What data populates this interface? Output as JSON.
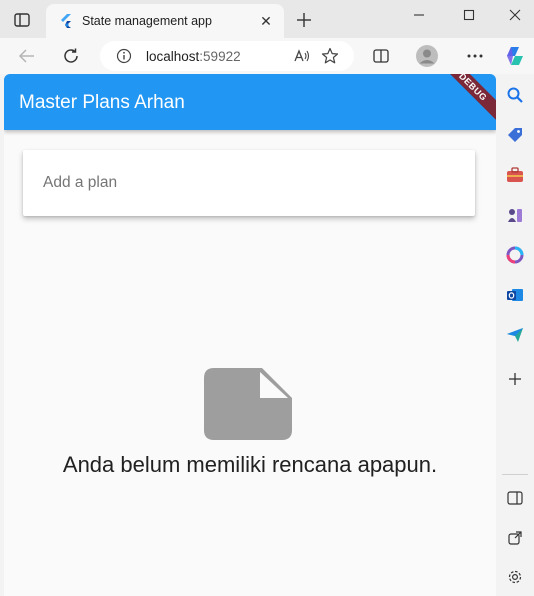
{
  "browser": {
    "tab": {
      "title": "State management app",
      "close_glyph": "✕"
    },
    "new_tab_glyph": "+",
    "window_controls": {
      "minimize": "—",
      "maximize": "☐",
      "close": "✕"
    },
    "address": {
      "host": "localhost",
      "port": ":59922"
    },
    "accent": "#2196f3"
  },
  "app": {
    "title": "Master Plans Arhan",
    "debug_banner": "DEBUG",
    "input": {
      "placeholder": "Add a plan",
      "value": ""
    },
    "empty_state": {
      "icon": "note-icon",
      "message": "Anda belum memiliki rencana apapun."
    }
  }
}
